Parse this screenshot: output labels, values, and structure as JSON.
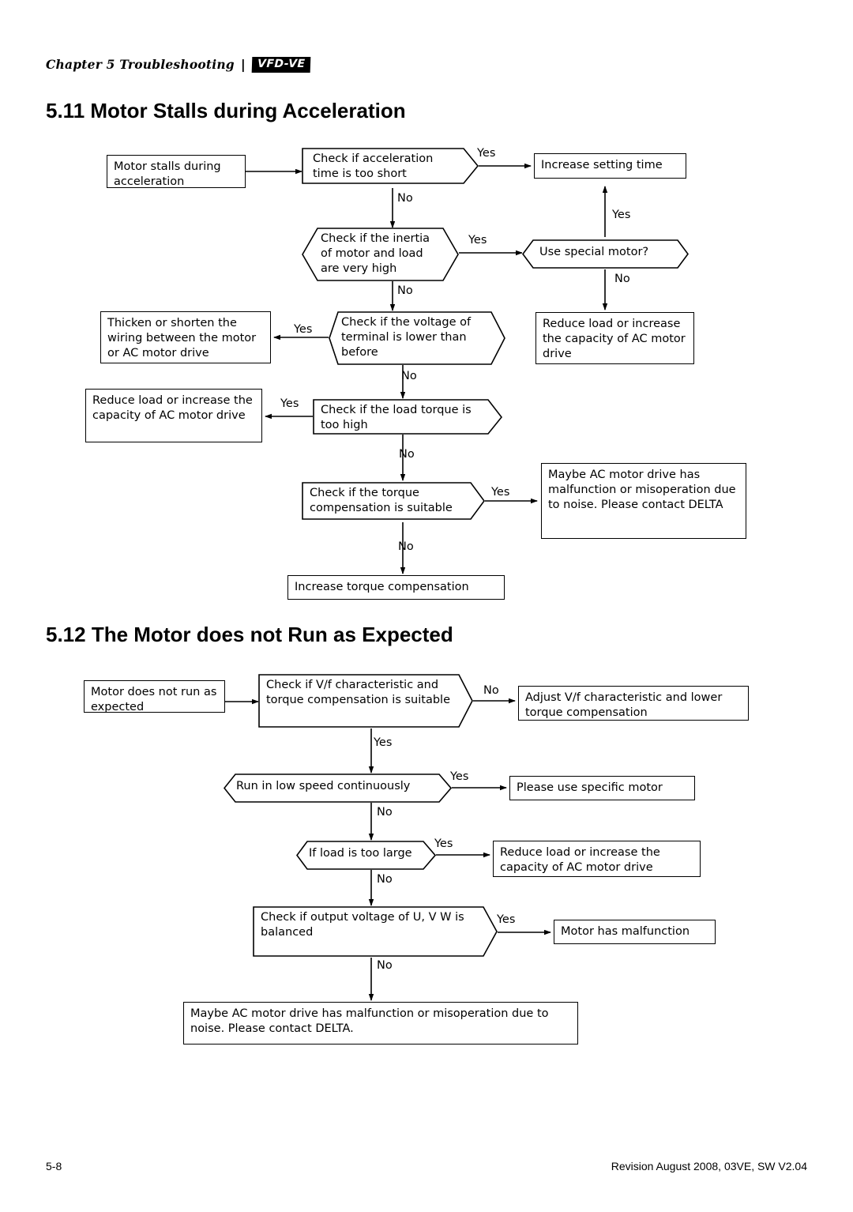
{
  "header": {
    "chapter": "Chapter 5  Troubleshooting",
    "separator": "|",
    "logo": "VFD-VE"
  },
  "sections": [
    {
      "id": "5.11",
      "title": "5.11 Motor Stalls during Acceleration"
    },
    {
      "id": "5.12",
      "title": "5.12 The Motor does not Run as Expected"
    }
  ],
  "flow_511": {
    "nodes": {
      "start": "Motor stalls during acceleration",
      "check_accel_time": "Check if acceleration time is too short",
      "increase_setting_time": "Increase setting time",
      "check_inertia": "Check if the inertia of motor and load are very high",
      "use_special_motor": "Use special motor?",
      "reduce_load_1": "Reduce load or increase the capacity of AC motor drive",
      "check_voltage": "Check if the voltage of terminal is lower than before",
      "thicken_wiring": "Thicken or shorten the wiring between the motor or AC motor drive",
      "check_load_torque": "Check if the load torque is too high",
      "reduce_load_2": "Reduce load or increase the capacity of AC motor drive",
      "check_torque_comp": "Check if the torque compensation is suitable",
      "maybe_malfunction": "Maybe AC motor drive has malfunction or misoperation due to noise. Please contact DELTA",
      "increase_torque_comp": "Increase torque compensation"
    },
    "labels": {
      "yes1": "Yes",
      "no1": "No",
      "yes2": "Yes",
      "yes_up": "Yes",
      "no2": "No",
      "no3": "No",
      "yes3": "Yes",
      "no4": "No",
      "yes4": "Yes",
      "no5": "No",
      "yes5": "Yes",
      "no6": "No"
    }
  },
  "flow_512": {
    "nodes": {
      "start": "Motor does not run as expected",
      "check_vf": "Check if V/f characteristic and torque compensation is suitable",
      "adjust_vf": "Adjust V/f characteristic and lower torque compensation",
      "run_low_speed": "Run in low speed continuously",
      "use_specific_motor": "Please use specific motor",
      "load_too_large": "If load is too large",
      "reduce_load": "Reduce load or increase the capacity of AC motor drive",
      "check_output_voltage": "Check if output voltage of U, V W is balanced",
      "motor_malfunction": "Motor  has malfunction",
      "maybe_malfunction": "Maybe AC motor drive has malfunction or misoperation due to noise. Please contact DELTA."
    },
    "labels": {
      "no1": "No",
      "yes1": "Yes",
      "yes2": "Yes",
      "no2": "No",
      "yes3": "Yes",
      "no3": "No",
      "yes4": "Yes",
      "no4": "No"
    }
  },
  "footer": {
    "page": "5-8",
    "revision": "Revision August 2008, 03VE, SW V2.04"
  }
}
